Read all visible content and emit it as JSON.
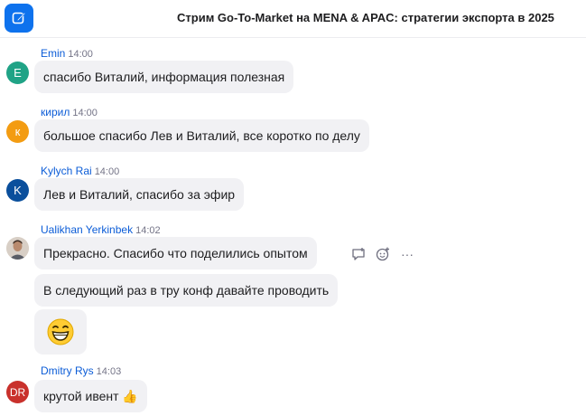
{
  "header": {
    "title": "Стрим Go-To-Market на MENA & APAC: стратегии экспорта в 2025",
    "compose_icon": "compose-icon"
  },
  "colors": {
    "accent": "#0e72ed",
    "sender_name": "#0b5cd7",
    "bubble_bg": "#f1f1f4"
  },
  "messages": [
    {
      "sender": "Emin",
      "time": "14:00",
      "avatar_text": "E",
      "avatar_color": "#20a386",
      "lines": [
        "спасибо Виталий, информация полезная"
      ]
    },
    {
      "sender": "кирил",
      "time": "14:00",
      "avatar_text": "к",
      "avatar_color": "#f39c12",
      "lines": [
        "большое спасибо Лев и Виталий, все коротко по делу"
      ]
    },
    {
      "sender": "Kylych Rai",
      "time": "14:00",
      "avatar_text": "K",
      "avatar_color": "#0a4f9c",
      "lines": [
        "Лев и Виталий, спасибо за эфир"
      ]
    },
    {
      "sender": "Ualikhan Yerkinbek",
      "time": "14:02",
      "avatar_text": "",
      "avatar_color": "#8a6a5a",
      "lines": [
        "Прекрасно. Спасибо что поделились опытом",
        "В следующий раз в тру конф давайте проводить"
      ],
      "emoji": "grinning-face-emoji"
    },
    {
      "sender": "Dmitry Rys",
      "time": "14:03",
      "avatar_text": "DR",
      "avatar_color": "#c9312c",
      "lines": [
        "крутой ивент 👍"
      ]
    }
  ],
  "message_actions": {
    "icons": [
      "reply-thread-icon",
      "add-reaction-icon",
      "more-icon"
    ],
    "more_glyph": "···"
  }
}
